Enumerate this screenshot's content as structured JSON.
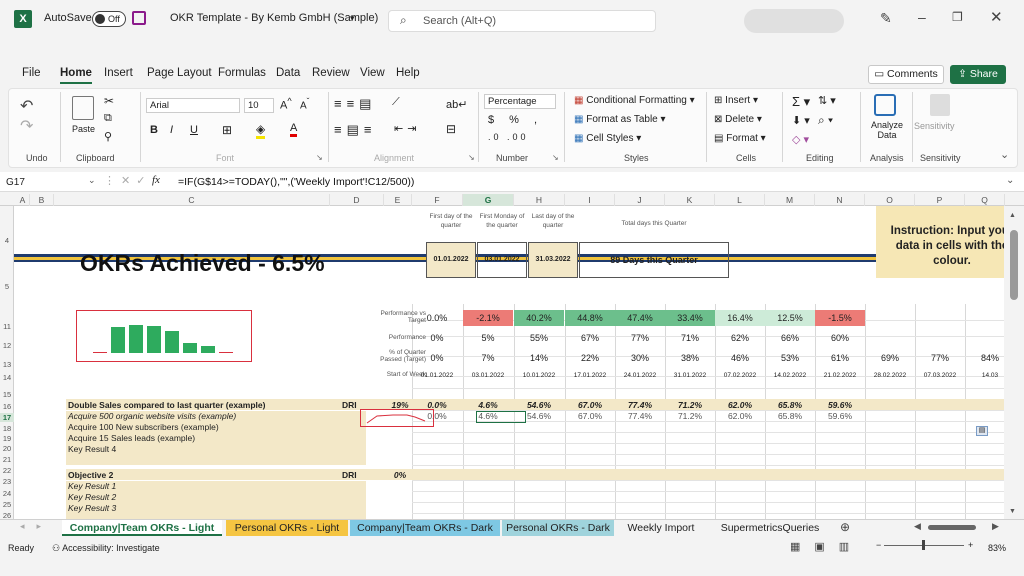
{
  "title_bar": {
    "autosave_label": "AutoSave",
    "autosave_state": "Off",
    "doc_title": "OKR Template - By Kemb GmbH (Sample)",
    "search_placeholder": "Search (Alt+Q)"
  },
  "menu": {
    "items": [
      "File",
      "Home",
      "Insert",
      "Page Layout",
      "Formulas",
      "Data",
      "Review",
      "View",
      "Help"
    ],
    "active": "Home",
    "comments_label": "Comments",
    "share_label": "Share"
  },
  "ribbon": {
    "undo_group": "Undo",
    "clipboard_group": "Clipboard",
    "paste_label": "Paste",
    "font_group": "Font",
    "font_name": "Arial",
    "font_size": "10",
    "alignment_group": "Alignment",
    "number_group": "Number",
    "number_format": "Percentage",
    "styles_group": "Styles",
    "conditional_formatting": "Conditional Formatting",
    "format_as_table": "Format as Table",
    "cell_styles": "Cell Styles",
    "cells_group": "Cells",
    "insert_label": "Insert",
    "delete_label": "Delete",
    "format_label": "Format",
    "editing_group": "Editing",
    "analyze_label": "Analyze Data",
    "analysis_group": "Analysis",
    "sensitivity_label": "Sensitivity",
    "sensitivity_group": "Sensitivity"
  },
  "formula_bar": {
    "cell_ref": "G17",
    "fx": "fx",
    "formula": "=IF(G$14>=TODAY(),\"\",('Weekly Import'!C12/500))"
  },
  "columns": [
    "A",
    "B",
    "C",
    "D",
    "E",
    "F",
    "G",
    "H",
    "I",
    "J",
    "K",
    "L",
    "M",
    "N",
    "O",
    "P",
    "Q"
  ],
  "rows": [
    "4",
    "5",
    "11",
    "12",
    "13",
    "14",
    "15",
    "16",
    "17",
    "18",
    "19",
    "20",
    "21",
    "22",
    "23",
    "24",
    "25",
    "26"
  ],
  "sheet": {
    "okr_title": "OKRs Achieved - 6.5%",
    "hdr_first_day": "First day of the quarter",
    "hdr_first_monday": "First Monday of the quarter",
    "hdr_last_day": "Last day of the quarter",
    "hdr_total_days": "Total days this Quarter",
    "val_first_day": "01.01.2022",
    "val_first_monday": "03.01.2022",
    "val_last_day": "31.03.2022",
    "val_total_days": "89 Days this Quarter",
    "instruction": "Instruction: Input your data in cells with the colour.",
    "lbl_perf_vs_target": "Performance vs Target",
    "lbl_performance": "Performance",
    "lbl_pct_quarter": "% of Quarter Passed (Target)",
    "lbl_start_week": "Start of Week",
    "perf_vs_target": [
      "0.0%",
      "-2.1%",
      "40.2%",
      "44.8%",
      "47.4%",
      "33.4%",
      "16.4%",
      "12.5%",
      "-1.5%"
    ],
    "performance": [
      "0%",
      "5%",
      "55%",
      "67%",
      "77%",
      "71%",
      "62%",
      "66%",
      "60%"
    ],
    "pct_quarter": [
      "0%",
      "7%",
      "14%",
      "22%",
      "30%",
      "38%",
      "46%",
      "53%",
      "61%",
      "69%",
      "77%",
      "84%"
    ],
    "start_week": [
      "01.01.2022",
      "03.01.2022",
      "10.01.2022",
      "17.01.2022",
      "24.01.2022",
      "31.01.2022",
      "07.02.2022",
      "14.02.2022",
      "21.02.2022",
      "28.02.2022",
      "07.03.2022",
      "14.03"
    ],
    "objective1": "Double Sales compared to last quarter (example)",
    "dri": "DRI",
    "obj1_pct": "19%",
    "obj1_values": [
      "0.0%",
      "4.6%",
      "54.6%",
      "67.0%",
      "77.4%",
      "71.2%",
      "62.0%",
      "65.8%",
      "59.6%"
    ],
    "kr1": "Acquire 500 organic website visits (example)",
    "kr1_values": [
      "0.0%",
      "4.6%",
      "54.6%",
      "67.0%",
      "77.4%",
      "71.2%",
      "62.0%",
      "65.8%",
      "59.6%"
    ],
    "kr2": "Acquire 100 New subscribers (example)",
    "kr3": "Acquire 15 Sales leads (example)",
    "kr4": "Key Result 4",
    "objective2": "Objective 2",
    "obj2_pct": "0%",
    "kr2_1": "Key Result 1",
    "kr2_2": "Key Result 2",
    "kr2_3": "Key Result 3",
    "sparkline_levels": [
      0,
      0.75,
      0.82,
      0.8,
      0.65,
      0.28,
      0.22,
      0
    ]
  },
  "tabs": {
    "items": [
      "Company|Team OKRs - Light",
      "Personal OKRs - Light",
      "Company|Team OKRs - Dark",
      "Personal OKRs - Dark",
      "Weekly Import",
      "SupermetricsQueries"
    ],
    "active": "Company|Team OKRs - Light"
  },
  "status": {
    "ready": "Ready",
    "accessibility": "Accessibility: Investigate",
    "zoom": "83%"
  },
  "colors": {
    "excel_green": "#1e7145",
    "input_cell": "#f3e8c8",
    "red_cell": "#ec7b76",
    "green_dark": "#6cbf8c",
    "green_light": "#cdebd8",
    "instruction_bg": "#f6e7b5",
    "tab_yellow": "#f5c542",
    "tab_blue": "#7ec8e3",
    "tab_teal": "#9fd3dc"
  }
}
